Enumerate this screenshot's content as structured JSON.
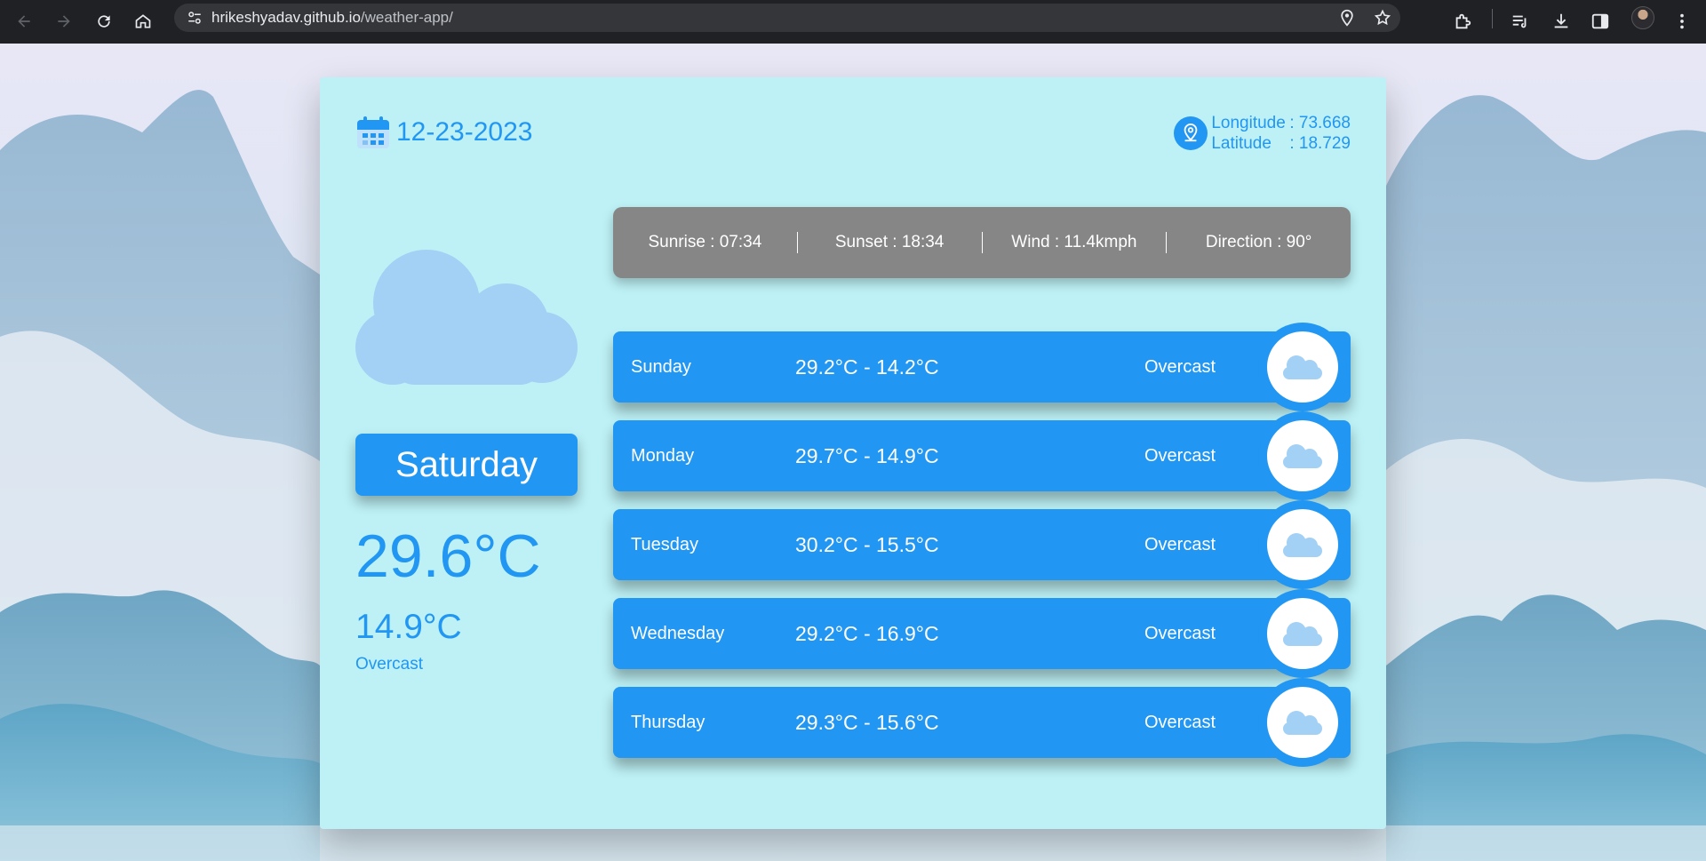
{
  "browser": {
    "url_host": "hrikeshyadav.github.io",
    "url_path": "/weather-app/"
  },
  "header": {
    "date": "12-23-2023",
    "longitude_label": "Longitude",
    "longitude_value": ": 73.668",
    "latitude_label": "Latitude",
    "latitude_value": ": 18.729"
  },
  "current": {
    "day": "Saturday",
    "temp": "29.6°C",
    "min_temp": "14.9°C",
    "condition": "Overcast",
    "icon": "cloud-icon"
  },
  "stats": {
    "sunrise": "Sunrise : 07:34",
    "sunset": "Sunset : 18:34",
    "wind": "Wind : 11.4kmph",
    "direction": "Direction : 90°"
  },
  "forecast": [
    {
      "day": "Sunday",
      "range": "29.2°C - 14.2°C",
      "condition": "Overcast",
      "icon": "cloud-icon"
    },
    {
      "day": "Monday",
      "range": "29.7°C - 14.9°C",
      "condition": "Overcast",
      "icon": "cloud-icon"
    },
    {
      "day": "Tuesday",
      "range": "30.2°C - 15.5°C",
      "condition": "Overcast",
      "icon": "cloud-icon"
    },
    {
      "day": "Wednesday",
      "range": "29.2°C - 16.9°C",
      "condition": "Overcast",
      "icon": "cloud-icon"
    },
    {
      "day": "Thursday",
      "range": "29.3°C - 15.6°C",
      "condition": "Overcast",
      "icon": "cloud-icon"
    }
  ],
  "colors": {
    "accent": "#2196f3",
    "card": "#bdf1f5",
    "stats_bar": "#868686",
    "cloud": "#a3d0f5"
  }
}
